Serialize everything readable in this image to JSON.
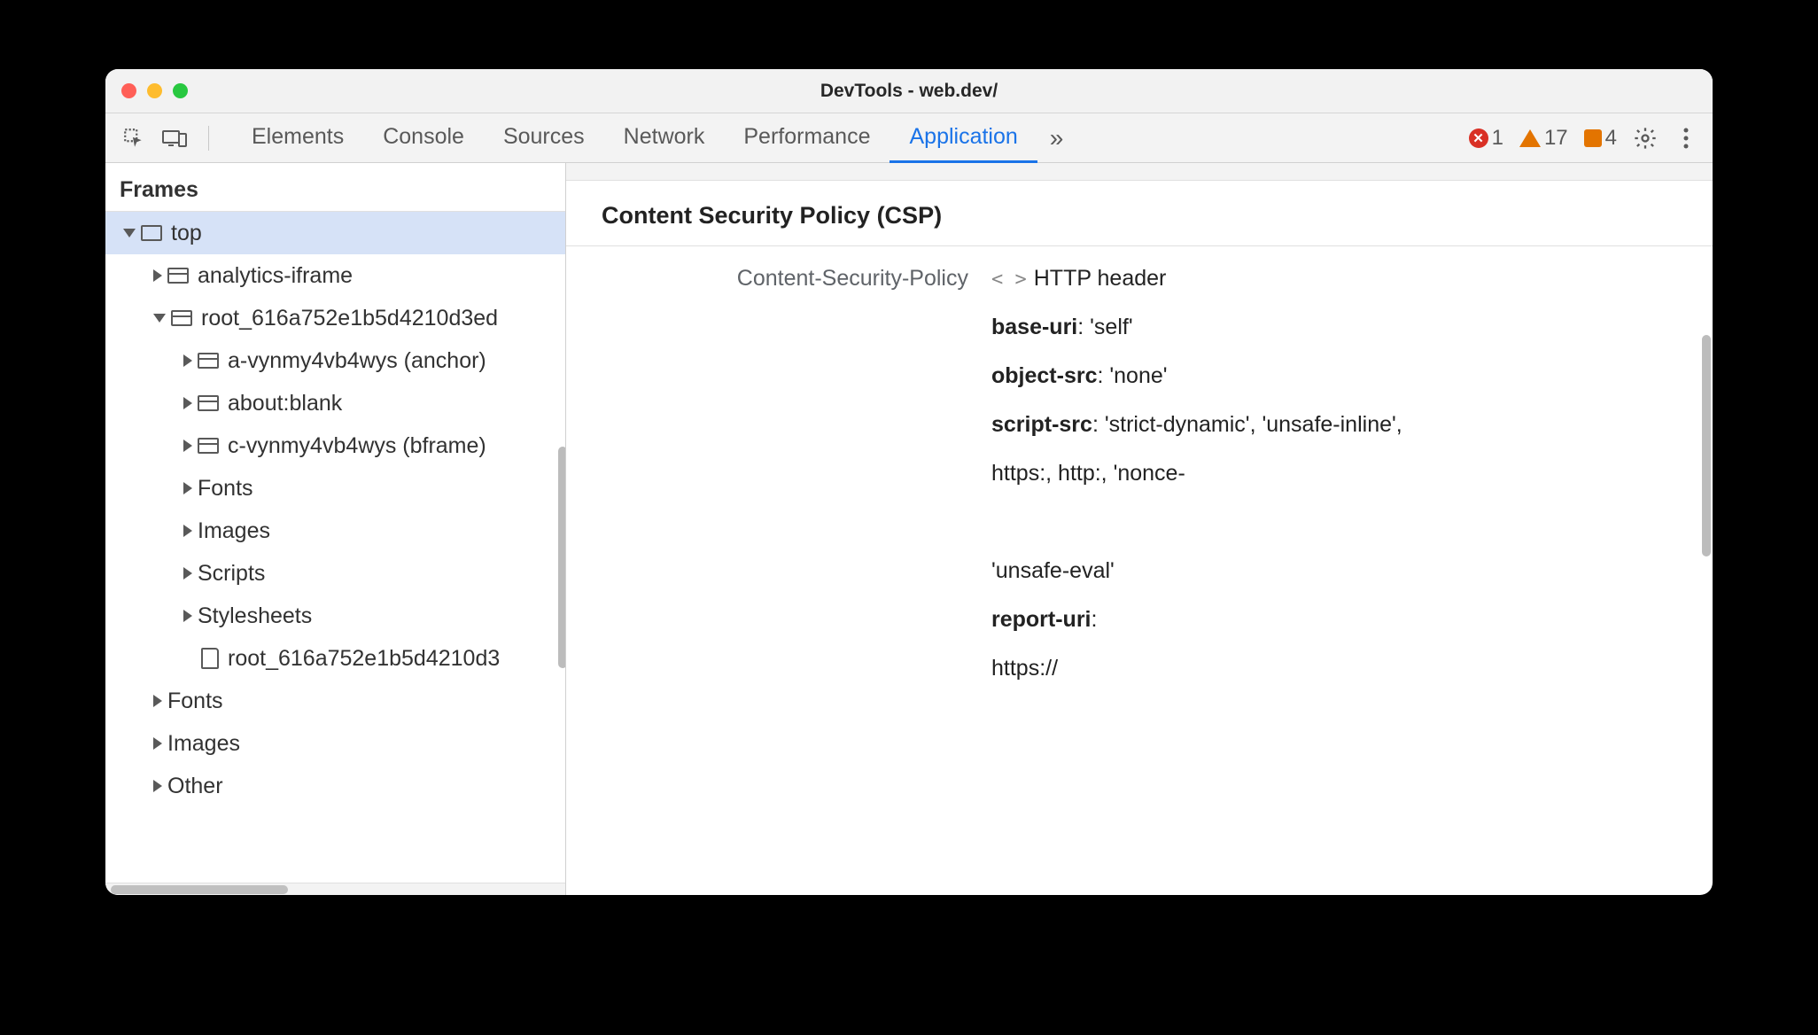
{
  "window": {
    "title": "DevTools - web.dev/"
  },
  "tabs": [
    "Elements",
    "Console",
    "Sources",
    "Network",
    "Performance",
    "Application"
  ],
  "activeTab": 5,
  "status": {
    "errors": "1",
    "warnings": "17",
    "issues": "4"
  },
  "sidebar": {
    "header": "Frames",
    "tree": [
      {
        "depth": 0,
        "arrow": "down",
        "icon": "frame",
        "label": "top",
        "selected": true
      },
      {
        "depth": 1,
        "arrow": "right",
        "icon": "iframe",
        "label": "analytics-iframe"
      },
      {
        "depth": 1,
        "arrow": "down",
        "icon": "iframe",
        "label": "root_616a752e1b5d4210d3ed"
      },
      {
        "depth": 2,
        "arrow": "right",
        "icon": "iframe",
        "label": "a-vynmy4vb4wys (anchor)"
      },
      {
        "depth": 2,
        "arrow": "right",
        "icon": "iframe",
        "label": "about:blank"
      },
      {
        "depth": 2,
        "arrow": "right",
        "icon": "iframe",
        "label": "c-vynmy4vb4wys (bframe)"
      },
      {
        "depth": 2,
        "arrow": "right",
        "icon": "",
        "label": "Fonts"
      },
      {
        "depth": 2,
        "arrow": "right",
        "icon": "",
        "label": "Images"
      },
      {
        "depth": 2,
        "arrow": "right",
        "icon": "",
        "label": "Scripts"
      },
      {
        "depth": 2,
        "arrow": "right",
        "icon": "",
        "label": "Stylesheets"
      },
      {
        "depth": 2,
        "arrow": "none",
        "icon": "doc",
        "label": "root_616a752e1b5d4210d3"
      },
      {
        "depth": 1,
        "arrow": "right",
        "icon": "",
        "label": "Fonts"
      },
      {
        "depth": 1,
        "arrow": "right",
        "icon": "",
        "label": "Images"
      },
      {
        "depth": 1,
        "arrow": "right",
        "icon": "",
        "label": "Other"
      }
    ]
  },
  "main": {
    "section_title": "Content Security Policy (CSP)",
    "detail_label": "Content-Security-Policy",
    "detail_source": "HTTP header",
    "directives": [
      {
        "name": "base-uri",
        "value": ": 'self'"
      },
      {
        "name": "object-src",
        "value": ": 'none'"
      },
      {
        "name": "script-src",
        "value": ": 'strict-dynamic', 'unsafe-inline',"
      },
      {
        "name": "",
        "value": "https:, http:, 'nonce-"
      },
      {
        "name": "",
        "value": " "
      },
      {
        "name": "",
        "value": "'unsafe-eval'"
      },
      {
        "name": "report-uri",
        "value": ":"
      },
      {
        "name": "",
        "value": "https://"
      }
    ]
  }
}
